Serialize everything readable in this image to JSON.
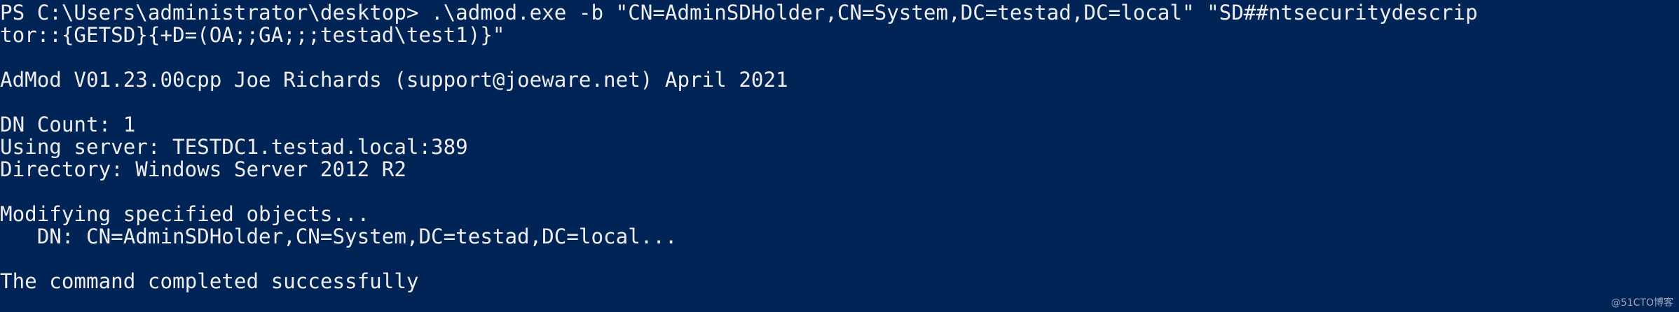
{
  "console": {
    "lines": [
      "PS C:\\Users\\administrator\\desktop> .\\admod.exe -b \"CN=AdminSDHolder,CN=System,DC=testad,DC=local\" \"SD##ntsecuritydescrip",
      "tor::{GETSD}{+D=(OA;;GA;;;testad\\test1)}\"",
      "",
      "AdMod V01.23.00cpp Joe Richards (support@joeware.net) April 2021",
      "",
      "DN Count: 1",
      "Using server: TESTDC1.testad.local:389",
      "Directory: Windows Server 2012 R2",
      "",
      "Modifying specified objects...",
      "   DN: CN=AdminSDHolder,CN=System,DC=testad,DC=local...",
      "",
      "The command completed successfully"
    ]
  },
  "watermark": "@51CTO博客",
  "colors": {
    "background": "#012456",
    "foreground": "#eeedf0"
  }
}
